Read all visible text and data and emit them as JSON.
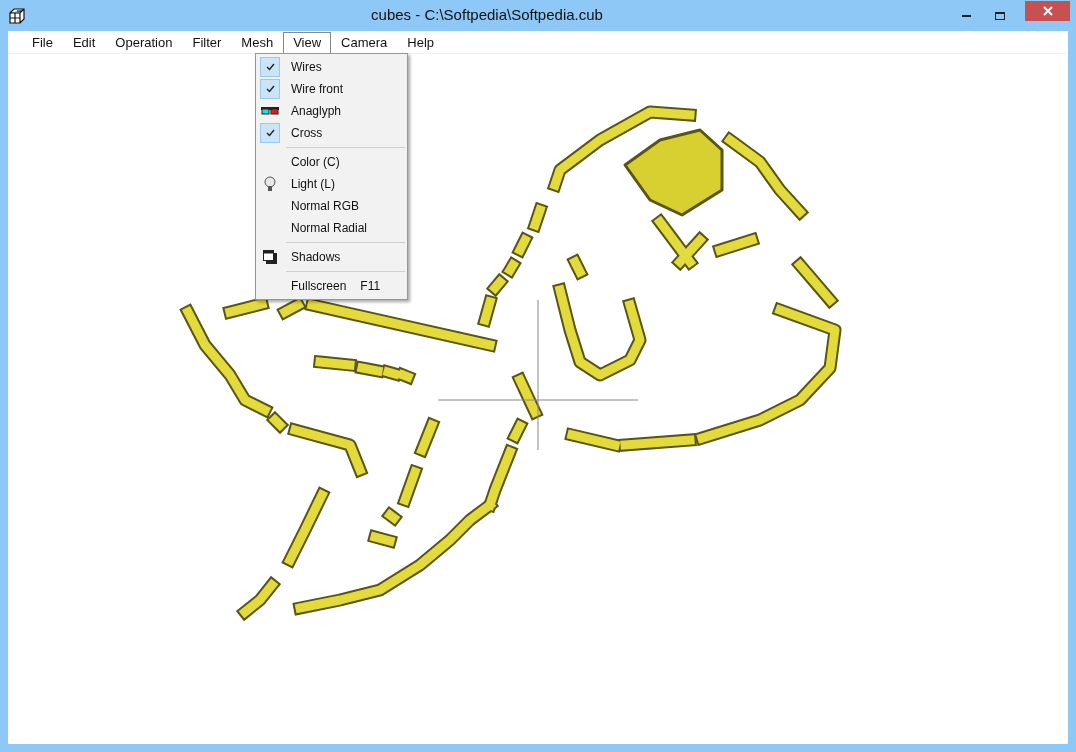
{
  "window": {
    "title": "cubes - C:\\Softpedia\\Softpedia.cub"
  },
  "menu_bar": [
    {
      "label": "File",
      "selected": false
    },
    {
      "label": "Edit",
      "selected": false
    },
    {
      "label": "Operation",
      "selected": false
    },
    {
      "label": "Filter",
      "selected": false
    },
    {
      "label": "Mesh",
      "selected": false
    },
    {
      "label": "View",
      "selected": true
    },
    {
      "label": "Camera",
      "selected": false
    },
    {
      "label": "Help",
      "selected": false
    }
  ],
  "view_menu": [
    {
      "kind": "check",
      "label": "Wires",
      "checked": true
    },
    {
      "kind": "check",
      "label": "Wire front",
      "checked": true
    },
    {
      "kind": "anaglyph",
      "label": "Anaglyph"
    },
    {
      "kind": "check",
      "label": "Cross",
      "checked": true
    },
    {
      "kind": "separator"
    },
    {
      "kind": "plain",
      "label": "Color (C)"
    },
    {
      "kind": "bulb",
      "label": "Light (L)"
    },
    {
      "kind": "plain",
      "label": "Normal RGB"
    },
    {
      "kind": "plain",
      "label": "Normal Radial"
    },
    {
      "kind": "separator"
    },
    {
      "kind": "shadow",
      "label": "Shadows"
    },
    {
      "kind": "separator"
    },
    {
      "kind": "plain",
      "label": "Fullscreen",
      "shortcut": "F11"
    }
  ]
}
